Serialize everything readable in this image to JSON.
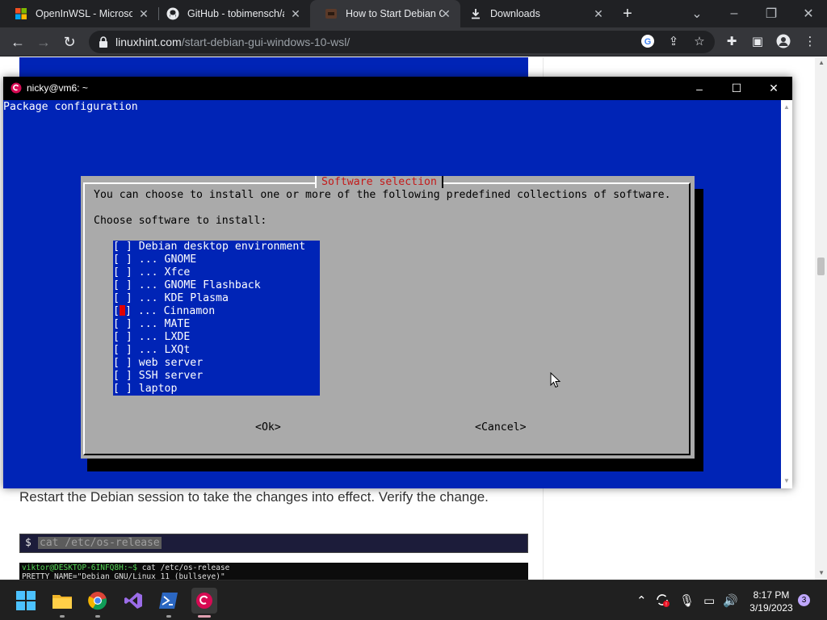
{
  "browser": {
    "tabs": [
      {
        "title": "OpenInWSL - Microsof",
        "icon": "windows-logo-icon"
      },
      {
        "title": "GitHub - tobimensch/a",
        "icon": "github-icon"
      },
      {
        "title": "How to Start Debian G",
        "icon": "linuxhint-icon",
        "active": true
      },
      {
        "title": "Downloads",
        "icon": "download-icon"
      }
    ],
    "url_host": "linuxhint.com",
    "url_path": "/start-debian-gui-windows-10-wsl/"
  },
  "article": {
    "text": "Restart the Debian session to take the changes into effect. Verify the change.",
    "command_prompt": "$",
    "command": "cat /etc/os-release",
    "terminal_lines": [
      {
        "user": "viktor@DESKTOP-6INFQ8H:~$",
        "text": " cat /etc/os-release"
      },
      {
        "user": "",
        "text": "PRETTY_NAME=\"Debian GNU/Linux 11 (bullseye)\""
      }
    ]
  },
  "terminal": {
    "title": "nicky@vm6: ~",
    "header": "Package configuration",
    "dialog": {
      "title": "Software selection",
      "description": "You can choose to install one or more of the following predefined collections of software.",
      "prompt": "Choose software to install:",
      "items": [
        "Debian desktop environment",
        "... GNOME",
        "... Xfce",
        "... GNOME Flashback",
        "... KDE Plasma",
        "... Cinnamon",
        "... MATE",
        "... LXDE",
        "... LXQt",
        "web server",
        "SSH server",
        "laptop"
      ],
      "cursor_index": 5,
      "ok_label": "<Ok>",
      "cancel_label": "<Cancel>"
    }
  },
  "taskbar": {
    "time": "8:17 PM",
    "date": "3/19/2023",
    "notification_count": "3"
  },
  "colors": {
    "terminal_blue": "#0024b6",
    "dialog_gray": "#aaaaaa",
    "dialog_title_red": "#c41a1a",
    "cursor_red": "#e00000"
  }
}
